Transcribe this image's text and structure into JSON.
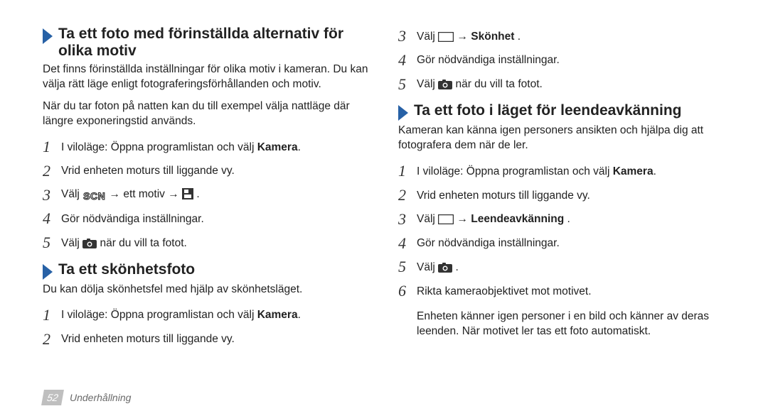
{
  "left": {
    "sec1": {
      "title": "Ta ett foto med förinställda alternativ för olika motiv",
      "p1": "Det finns förinställda inställningar för olika motiv i kameran. Du kan välja rätt läge enligt fotograferingsförhållanden och motiv.",
      "p2": "När du tar foton på natten kan du till exempel välja nattläge där längre exponeringstid används.",
      "steps": [
        {
          "pre": "I viloläge: Öppna programlistan och välj ",
          "bold": "Kamera",
          "post": "."
        },
        {
          "text": "Vrid enheten moturs till liggande vy."
        },
        {
          "scn_step_prefix": "Välj ",
          "scn_step_mid": " → ett motiv → ",
          "scn_step_suffix": "."
        },
        {
          "text": "Gör nödvändiga inställningar."
        },
        {
          "camera_step_prefix": "Välj ",
          "camera_step_suffix": " när du vill ta fotot."
        }
      ]
    },
    "sec2": {
      "title": "Ta ett skönhetsfoto",
      "p1": "Du kan dölja skönhetsfel med hjälp av skönhetsläget.",
      "steps": [
        {
          "pre": "I viloläge: Öppna programlistan och välj ",
          "bold": "Kamera",
          "post": "."
        },
        {
          "text": "Vrid enheten moturs till liggande vy."
        }
      ]
    }
  },
  "right": {
    "topsteps": [
      {
        "box_step_prefix": "Välj ",
        "box_step_mid": " → ",
        "box_step_bold": "Skönhet",
        "box_step_suffix": "."
      },
      {
        "text": "Gör nödvändiga inställningar."
      },
      {
        "camera_step_prefix": "Välj ",
        "camera_step_suffix": " när du vill ta fotot."
      }
    ],
    "topstart": 3,
    "sec3": {
      "title": "Ta ett foto i läget för leendeavkänning",
      "p1": "Kameran kan känna igen personers ansikten och hjälpa dig att fotografera dem när de ler.",
      "steps": [
        {
          "pre": "I viloläge: Öppna programlistan och välj ",
          "bold": "Kamera",
          "post": "."
        },
        {
          "text": "Vrid enheten moturs till liggande vy."
        },
        {
          "box_step_prefix": "Välj ",
          "box_step_mid": " → ",
          "box_step_bold": "Leendeavkänning",
          "box_step_suffix": "."
        },
        {
          "text": "Gör nödvändiga inställningar."
        },
        {
          "camera_step_prefix": "Välj ",
          "camera_step_suffix": "."
        },
        {
          "text": "Rikta kameraobjektivet mot motivet."
        }
      ],
      "p2": "Enheten känner igen personer i en bild och känner av deras leenden. När motivet ler tas ett foto automatiskt."
    }
  },
  "footer": {
    "page": "52",
    "section": "Underhållning"
  },
  "_nums": [
    "1",
    "2",
    "3",
    "4",
    "5",
    "6"
  ]
}
